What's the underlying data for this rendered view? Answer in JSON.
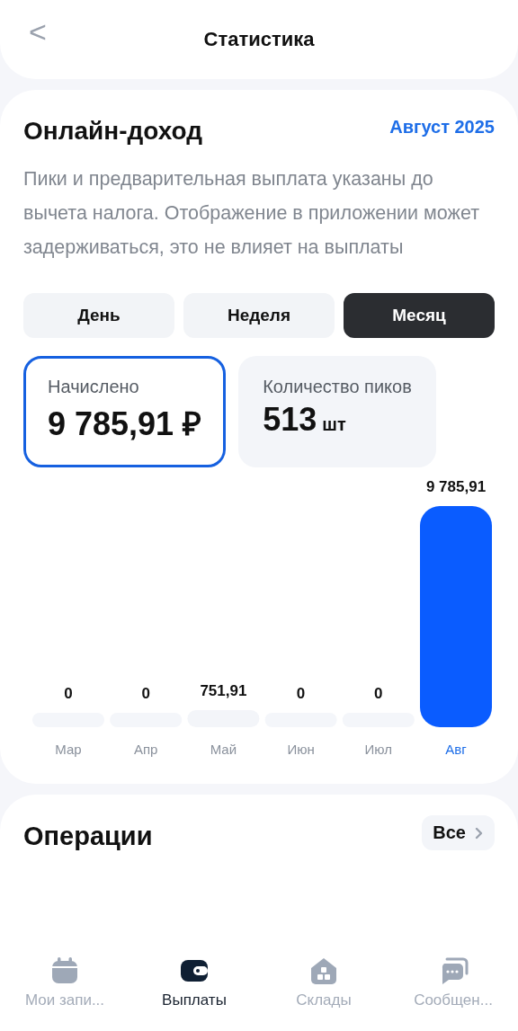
{
  "header": {
    "back": "<",
    "title": "Статистика"
  },
  "income": {
    "title": "Онлайн-доход",
    "period": "Август 2025",
    "description": "Пики и предварительная выплата указаны до вычета налога. Отображение в приложении может задерживаться, это не влияет на выплаты",
    "periods": [
      {
        "label": "День",
        "selected": false
      },
      {
        "label": "Неделя",
        "selected": false
      },
      {
        "label": "Месяц",
        "selected": true
      }
    ],
    "stats": [
      {
        "label": "Начислено",
        "value": "9 785,91 ₽",
        "selected": true
      },
      {
        "label": "Количество пиков",
        "value": "513",
        "unit": "шт",
        "selected": false
      }
    ],
    "bar_states": [
      {
        "selected": false
      },
      {
        "selected": false
      },
      {
        "selected": false
      },
      {
        "selected": false
      },
      {
        "selected": false
      },
      {
        "selected": true
      }
    ],
    "chart_data": {
      "type": "bar",
      "categories": [
        "Мар",
        "Апр",
        "Май",
        "Июн",
        "Июл",
        "Авг"
      ],
      "values": [
        0,
        0,
        751.91,
        0,
        0,
        9785.91
      ],
      "data_labels": true,
      "value_labels": [
        "0",
        "0",
        "751,91",
        "0",
        "0",
        "9 785,91"
      ]
    }
  },
  "operations": {
    "title": "Операции",
    "all_button": "Все"
  },
  "nav": [
    {
      "label": "Мои запи...",
      "kind": "calendar",
      "selected": false
    },
    {
      "label": "Выплаты",
      "kind": "wallet",
      "selected": true
    },
    {
      "label": "Склады",
      "kind": "warehouse",
      "selected": false
    },
    {
      "label": "Сообщен...",
      "kind": "chat",
      "selected": false
    }
  ]
}
